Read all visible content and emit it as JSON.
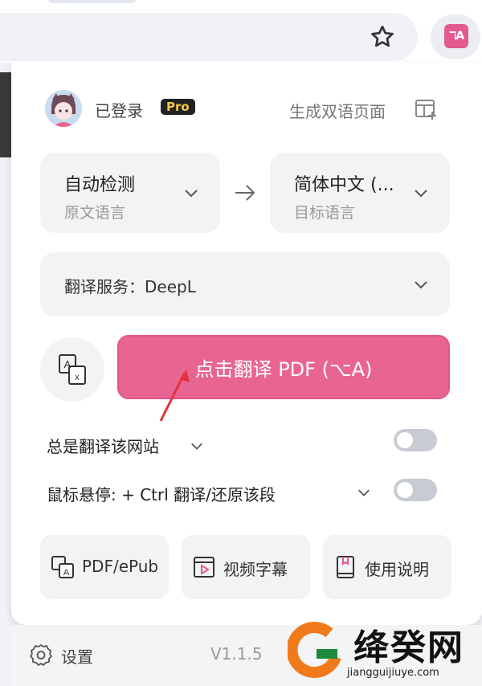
{
  "browser": {
    "bookmark_icon": "star-icon",
    "extension_icon": "translate-icon",
    "extension_logo_text": "ℸA"
  },
  "popup": {
    "account": {
      "status": "已登录",
      "badge": "Pro",
      "avatar_icon": "avatar-icon"
    },
    "generate_bilingual_label": "生成双语页面",
    "source_lang": {
      "value": "自动检测",
      "label": "原文语言"
    },
    "target_lang": {
      "value": "简体中文 (...",
      "label": "目标语言"
    },
    "service_label": "翻译服务：DeepL",
    "translate_button": "点击翻译 PDF (⌥A)",
    "always_translate_label": "总是翻译该网站",
    "hover_label": "鼠标悬停: + Ctrl 翻译/还原该段",
    "toggles": {
      "always_translate": false,
      "hover_translate": false
    },
    "tools": [
      {
        "label": "PDF/ePub",
        "icon": "pdf-icon"
      },
      {
        "label": "视频字幕",
        "icon": "video-icon"
      },
      {
        "label": "使用说明",
        "icon": "book-icon"
      }
    ],
    "footer": {
      "settings": "设置",
      "version": "V1.1.5"
    }
  },
  "watermark": {
    "name": "绛癸网",
    "url": "jiangguijiuye.com"
  },
  "colors": {
    "accent": "#e86591",
    "pro_badge_bg": "#222222",
    "pro_badge_text": "#f6c845",
    "panel_bg": "#f2f3f5"
  }
}
